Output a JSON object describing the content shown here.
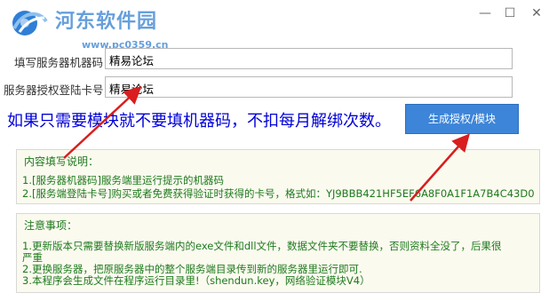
{
  "window": {
    "watermark": "河东软件园",
    "watermark_url": "www.pc0359.cn",
    "minimize_glyph": "—",
    "maximize_glyph": "☐",
    "close_glyph": "✕"
  },
  "form": {
    "machine_code_label": "填写服务器机器码：",
    "machine_code_value": "精易论坛",
    "auth_card_label": "服务器授权登陆卡号：",
    "auth_card_value": "精易论坛"
  },
  "notice": "如果只需要模块就不要填机器码，不扣每月解绑次数。",
  "generate_button": "生成授权/模块",
  "instructions": {
    "title": "内容填写说明：",
    "lines": [
      "1.[服务器机器码]服务端里运行提示的机器码",
      "2.[服务端登陆卡号]购买或者免费获得验证时获得的卡号，格式如：YJ9BBB421HF5EF6A8F0A1F1A7B4C43D0"
    ]
  },
  "cautions": {
    "title": "注意事项：",
    "lines": [
      "1.更新版本只需要替换新版服务端内的exe文件和dll文件，数据文件夹不要替换，否则资料全没了，后果很",
      "严重",
      "2.更换服务器，把原服务器中的整个服务端目录传到新的服务器里运行即可.",
      "3.本程序会生成文件在程序运行目录里!（shendun.key，网络验证模块V4）"
    ]
  },
  "colors": {
    "notice_text": "#0000d8",
    "button_bg": "#3d85d8",
    "box_text": "#1e7a1e",
    "box_bg": "#fbfaef",
    "arrow": "#d81e1e"
  }
}
